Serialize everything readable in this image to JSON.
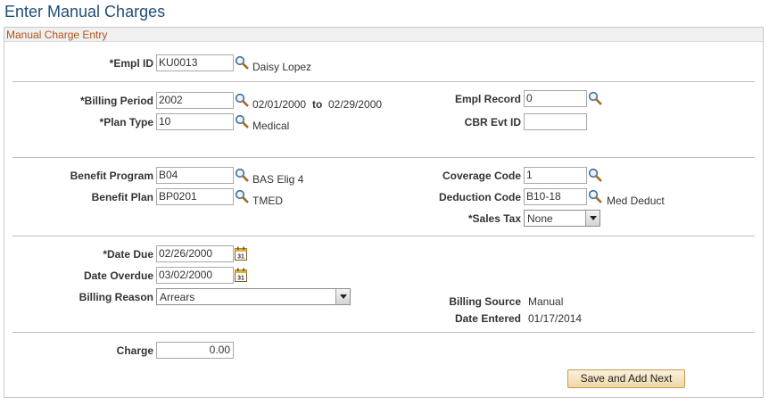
{
  "page": {
    "title": "Enter Manual Charges"
  },
  "groupbox": {
    "title": "Manual Charge Entry"
  },
  "empl": {
    "label": "*Empl ID",
    "value": "KU0013",
    "name": "Daisy Lopez"
  },
  "billing": {
    "period_label": "*Billing Period",
    "period_value": "2002",
    "from_date": "02/01/2000",
    "to_label": "to",
    "to_date": "02/29/2000",
    "plan_type_label": "*Plan Type",
    "plan_type_value": "10",
    "plan_type_desc": "Medical",
    "empl_record_label": "Empl Record",
    "empl_record_value": "0",
    "cbr_label": "CBR Evt ID",
    "cbr_value": ""
  },
  "benefit": {
    "program_label": "Benefit Program",
    "program_value": "B04",
    "program_desc": "BAS Elig 4",
    "plan_label": "Benefit Plan",
    "plan_value": "BP0201",
    "plan_desc": "TMED",
    "coverage_label": "Coverage Code",
    "coverage_value": "1",
    "deduction_label": "Deduction Code",
    "deduction_value": "B10-18",
    "deduction_desc": "Med Deduct",
    "sales_tax_label": "*Sales Tax",
    "sales_tax_value": "None"
  },
  "dates": {
    "due_label": "*Date Due",
    "due_value": "02/26/2000",
    "overdue_label": "Date Overdue",
    "overdue_value": "03/02/2000",
    "reason_label": "Billing Reason",
    "reason_value": "Arrears",
    "source_label": "Billing Source",
    "source_value": "Manual",
    "entered_label": "Date Entered",
    "entered_value": "01/17/2014"
  },
  "charge": {
    "label": "Charge",
    "value": "0.00"
  },
  "actions": {
    "save_next_label": "Save and Add Next"
  },
  "icons": {
    "lookup": "magnifier-icon",
    "calendar": "calendar-icon",
    "dropdown": "chevron-down-icon"
  },
  "colors": {
    "title": "#1f4e79",
    "group_title": "#b0541c",
    "button_bg": "#f5e3bd"
  }
}
